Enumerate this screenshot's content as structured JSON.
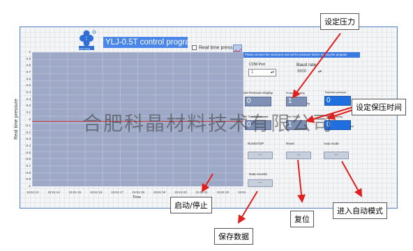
{
  "app": {
    "title": "YLJ-0.5T control program",
    "logo_text": "Hefei Kejing"
  },
  "chart": {
    "realtime_checkbox_label": "Real time pressure",
    "ylabel": "Real time pressure",
    "xlabel": "Time",
    "yticks": [
      "1",
      "0.9",
      "0.8",
      "0.7",
      "0.6",
      "0.5",
      "0.4",
      "0.3",
      "0.2",
      "0.1",
      "0",
      "-0.1",
      "-0.2",
      "-0.3",
      "-0.4",
      "-0.5",
      "-0.6",
      "-0.7",
      "-0.8",
      "-0.9",
      "-1"
    ],
    "xticks": [
      "15:51:13",
      "15:51:14",
      "15:51:15",
      "15:51:16",
      "15:51:17",
      "15:51:18",
      "15:51:19",
      "15:51:20",
      "15:51:21",
      "15:51:22",
      "15:51"
    ],
    "line_color": "#d23a3a",
    "bg_color": "#9ea9c7"
  },
  "panel": {
    "instruction": "Please connect the serial port and set the pressure before running the program",
    "com_port_label": "COM Port",
    "com_port_value": "1",
    "baud_rate_label": "Baud rate",
    "baud_rate_value": "9600",
    "set_pressure_display_label": "Set Pressure Display",
    "set_pressure_display_value": "0",
    "pressure_setting_label": "Pressure Setting",
    "pressure_setting_value": "1",
    "pressure_unit": "kg",
    "realtime_pressure_label": "Real time pressure",
    "realtime_pressure_value": "0",
    "set_time_display_label": "Set Time Display",
    "set_time_display_value": "0",
    "time_setting_label": "Time Setting",
    "time_setting_value": "1",
    "time_remaining_label": "Time remaining",
    "time_remaining_value": "0",
    "time_unit": "min",
    "run_stop_label": "RUN/STOP",
    "reset_label": "Reset",
    "auto_mode_label": "Auto mode",
    "data_records_label": "Data records",
    "button_dash": "---"
  },
  "annotations": {
    "set_pressure": "设定压力",
    "set_hold_time": "设定保压时间",
    "start_stop": "启动/停止",
    "save_data": "保存数据",
    "reset": "复位",
    "auto_mode": "进入自动模式"
  },
  "watermark": "合肥科晶材料技术有限公司",
  "colors": {
    "accent": "#4a86e8",
    "arrow": "#e0201d"
  }
}
